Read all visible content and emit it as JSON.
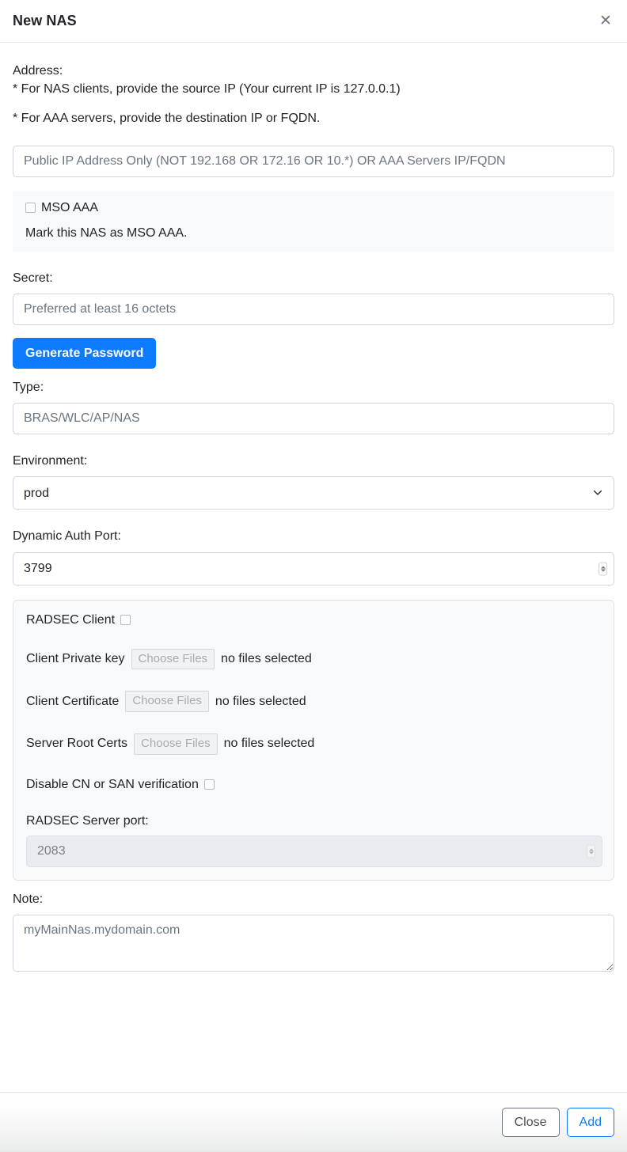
{
  "dialog": {
    "title": "New NAS",
    "close_icon": "close-icon"
  },
  "address": {
    "label": "Address:",
    "hint_1": "* For NAS clients, provide the source IP (Your current IP is 127.0.0.1)",
    "hint_2": "* For AAA servers, provide the destination IP or FQDN.",
    "placeholder": "Public IP Address Only (NOT 192.168 OR 172.16 OR 10.*) OR AAA Servers IP/FQDN",
    "value": ""
  },
  "mso": {
    "checkbox_label": "MSO AAA",
    "description": "Mark this NAS as MSO AAA.",
    "checked": false
  },
  "secret": {
    "label": "Secret:",
    "placeholder": "Preferred at least 16 octets",
    "value": "",
    "generate_button": "Generate Password"
  },
  "type": {
    "label": "Type:",
    "placeholder": "BRAS/WLC/AP/NAS",
    "value": ""
  },
  "environment": {
    "label": "Environment:",
    "selected": "prod",
    "options": [
      "prod"
    ],
    "chevron_icon": "chevron-down-icon"
  },
  "dynamic_auth_port": {
    "label": "Dynamic Auth Port:",
    "value": "3799",
    "spinner_icon": "spinner-updown-icon"
  },
  "radsec": {
    "title": "RADSEC Client",
    "enabled": false,
    "files": [
      {
        "label": "Client Private key",
        "button": "Choose Files",
        "status": "no files selected"
      },
      {
        "label": "Client Certificate",
        "button": "Choose Files",
        "status": "no files selected"
      },
      {
        "label": "Server Root Certs",
        "button": "Choose Files",
        "status": "no files selected"
      }
    ],
    "disable_cn_label": "Disable CN or SAN verification",
    "disable_cn_checked": false,
    "server_port_label": "RADSEC Server port:",
    "server_port_value": "2083"
  },
  "note": {
    "label": "Note:",
    "placeholder": "myMainNas.mydomain.com",
    "value": ""
  },
  "footer": {
    "close_label": "Close",
    "add_label": "Add"
  },
  "colors": {
    "primary": "#0d7bff",
    "body_text": "#212529",
    "muted_text": "#6c757d",
    "border": "#ced4da",
    "panel_bg": "#f8f9fa",
    "disabled_bg": "#e9ecef"
  }
}
